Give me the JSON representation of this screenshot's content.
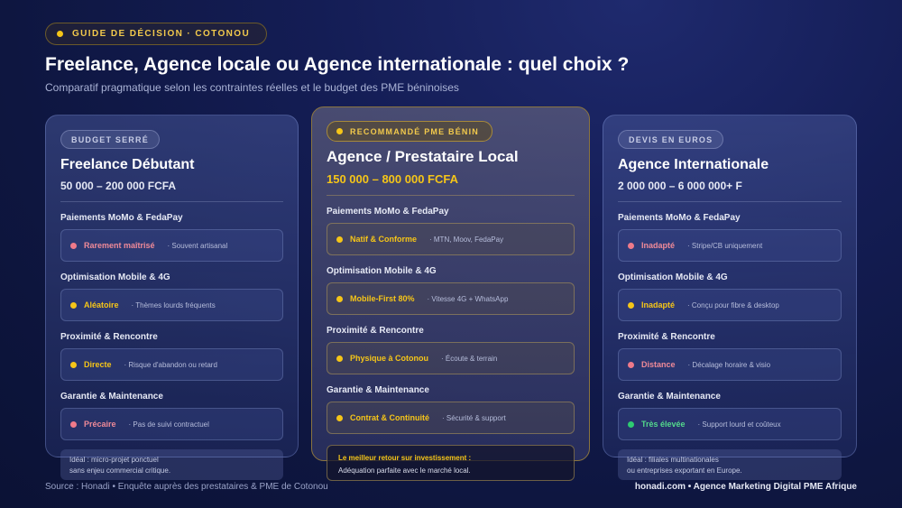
{
  "header": {
    "tag": "GUIDE DE DÉCISION · COTONOU",
    "title": "Freelance, Agence locale ou Agence internationale : quel choix ?",
    "subtitle": "Comparatif pragmatique selon les contraintes réelles et le budget des PME béninoises"
  },
  "colors": {
    "gold": "#f5c518",
    "pink": "#ef7a8a",
    "green": "#2ecc71",
    "background": "#141d55"
  },
  "cards": [
    {
      "badge": "BUDGET SERRÉ",
      "title": "Freelance Débutant",
      "price": "50 000 – 200 000 FCFA",
      "sections": [
        {
          "label": "Paiements MoMo & FedaPay",
          "value": "Rarement maîtrisé",
          "note": "· Souvent artisanal",
          "status": "pink"
        },
        {
          "label": "Optimisation Mobile & 4G",
          "value": "Aléatoire",
          "note": "· Thèmes lourds fréquents",
          "status": "gold"
        },
        {
          "label": "Proximité & Rencontre",
          "value": "Directe",
          "note": "· Risque d'abandon ou retard",
          "status": "gold"
        },
        {
          "label": "Garantie & Maintenance",
          "value": "Précaire",
          "note": "· Pas de suivi contractuel",
          "status": "pink"
        }
      ],
      "ideal_line1": "Idéal : micro-projet ponctuel",
      "ideal_line2": "sans enjeu commercial critique."
    },
    {
      "badge": "RECOMMANDÉ PME BÉNIN",
      "title": "Agence / Prestataire Local",
      "price": "150 000 – 800 000 FCFA",
      "sections": [
        {
          "label": "Paiements MoMo & FedaPay",
          "value": "Natif & Conforme",
          "note": "· MTN, Moov, FedaPay",
          "status": "gold"
        },
        {
          "label": "Optimisation Mobile & 4G",
          "value": "Mobile-First 80%",
          "note": "· Vitesse 4G + WhatsApp",
          "status": "gold"
        },
        {
          "label": "Proximité & Rencontre",
          "value": "Physique à Cotonou",
          "note": "· Écoute & terrain",
          "status": "gold"
        },
        {
          "label": "Garantie & Maintenance",
          "value": "Contrat & Continuité",
          "note": "· Sécurité & support",
          "status": "gold"
        }
      ],
      "best_title": "Le meilleur retour sur investissement :",
      "best_text": "Adéquation parfaite avec le marché local."
    },
    {
      "badge": "DEVIS EN EUROS",
      "title": "Agence Internationale",
      "price": "2 000 000 – 6 000 000+ F",
      "sections": [
        {
          "label": "Paiements MoMo & FedaPay",
          "value": "Inadapté",
          "note": "· Stripe/CB uniquement",
          "status": "pink"
        },
        {
          "label": "Optimisation Mobile & 4G",
          "value": "Inadapté",
          "note": "· Conçu pour fibre & desktop",
          "status": "gold"
        },
        {
          "label": "Proximité & Rencontre",
          "value": "Distance",
          "note": "· Décalage horaire & visio",
          "status": "pink"
        },
        {
          "label": "Garantie & Maintenance",
          "value": "Très élevée",
          "note": "· Support lourd et coûteux",
          "status": "green"
        }
      ],
      "ideal_line1": "Idéal : filiales multinationales",
      "ideal_line2": "ou entreprises exportant en Europe."
    }
  ],
  "footer": {
    "source": "Source : Honadi • Enquête auprès des prestataires & PME de Cotonou",
    "brand": "honadi.com • Agence Marketing Digital PME Afrique"
  }
}
